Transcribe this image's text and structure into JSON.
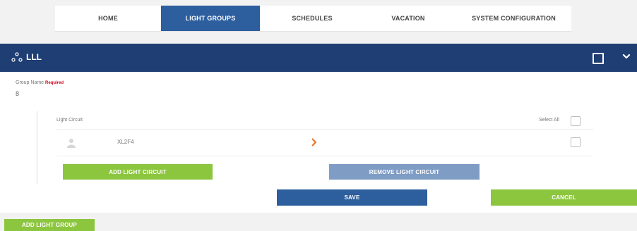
{
  "nav": {
    "tabs": [
      {
        "label": "HOME",
        "active": false
      },
      {
        "label": "LIGHT GROUPS",
        "active": true
      },
      {
        "label": "SCHEDULES",
        "active": false
      },
      {
        "label": "VACATION",
        "active": false
      },
      {
        "label": "SYSTEM CONFIGURATION",
        "active": false
      }
    ]
  },
  "group": {
    "title": "LLL",
    "icon": "group-icon",
    "name_label": "Group Name",
    "required_label": "Required",
    "name_value": "8"
  },
  "circuits": {
    "header_label": "Light Circuit",
    "select_all_label": "Select All",
    "items": [
      {
        "name": "XL2F4",
        "icon": "person-icon",
        "arrow": "chevron-right-icon"
      }
    ]
  },
  "buttons": {
    "add_circuit": "ADD LIGHT CIRCUIT",
    "remove_circuit": "REMOVE LIGHT CIRCUIT",
    "save": "SAVE",
    "cancel": "CANCEL",
    "add_group": "ADD LIGHT GROUP"
  },
  "colors": {
    "header_bar": "#1f3e74",
    "active_tab": "#2d5e9e",
    "green": "#8cc63f",
    "steel": "#7f9cc4",
    "arrow": "#e8752a",
    "required": "#d0021b"
  }
}
